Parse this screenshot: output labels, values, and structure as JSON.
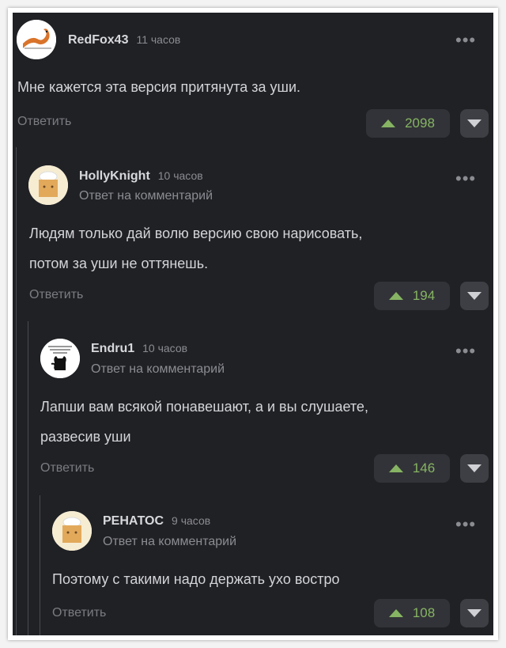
{
  "colors": {
    "upvote": "#86b463",
    "background": "#202125"
  },
  "comments": [
    {
      "username": "RedFox43",
      "time": "11 часов",
      "reply_to": "",
      "text_lines": [
        "Мне кажется эта версия притянута за уши."
      ],
      "reply_label": "Ответить",
      "votes": "2098",
      "avatar_icon": "fox-icon"
    },
    {
      "username": "HollyKnight",
      "time": "10 часов",
      "reply_to": "Ответ на комментарий",
      "text_lines": [
        "Людям только дай волю версию свою нарисовать,",
        "потом за уши не оттянешь."
      ],
      "reply_label": "Ответить",
      "votes": "194",
      "avatar_icon": "baker-box-icon"
    },
    {
      "username": "Endru1",
      "time": "10 часов",
      "reply_to": "Ответ на комментарий",
      "text_lines": [
        "Лапши вам всякой понавешают, а и вы слушаете,",
        "развесив уши"
      ],
      "reply_label": "Ответить",
      "votes": "146",
      "avatar_icon": "cat-meme-icon"
    },
    {
      "username": "РЕНАТОС",
      "time": "9 часов",
      "reply_to": "Ответ на комментарий",
      "text_lines": [
        "Поэтому с такими надо держать ухо востро"
      ],
      "reply_label": "Ответить",
      "votes": "108",
      "avatar_icon": "baker-box-icon"
    }
  ]
}
